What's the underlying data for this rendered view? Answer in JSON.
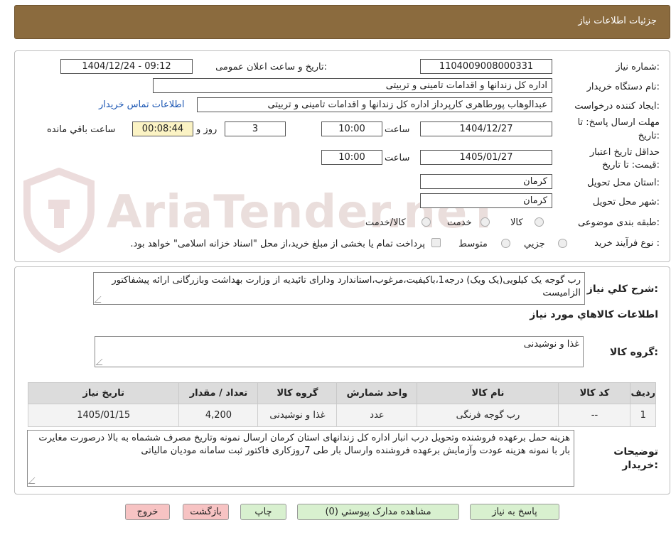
{
  "header": {
    "title": "جزئیات اطلاعات نیاز"
  },
  "form": {
    "need_number": {
      "label": "شماره نیاز:",
      "value": "1104009008000331"
    },
    "announce": {
      "label": "تاریخ و ساعت اعلان عمومی:",
      "value": "1404/12/24 - 09:12"
    },
    "buyer_org": {
      "label": "نام دستگاه خریدار:",
      "value": "اداره کل زندانها و اقدامات تامینی و تربیتی"
    },
    "requester": {
      "label": "ایجاد کننده درخواست:",
      "value": "عبدالوهاب پورطاهری کارپرداز اداره کل زندانها و اقدامات تامینی و تربیتی",
      "link": "اطلاعات تماس خریدار"
    },
    "reply_deadline": {
      "label_line1": "مهلت ارسال پاسخ: تا",
      "label_line2": "تاریخ:",
      "date": "1404/12/27",
      "time_label": "ساعت",
      "time": "10:00",
      "days": "3",
      "days_label": "روز و",
      "remaining": "00:08:44",
      "remaining_label": "ساعت باقي مانده"
    },
    "price_validity": {
      "label_line1": "حداقل تاریخ اعتبار",
      "label_line2": "قیمت: تا تاریخ:",
      "date": "1405/01/27",
      "time_label": "ساعت",
      "time": "10:00"
    },
    "province": {
      "label": "استان محل تحویل:",
      "value": "کرمان"
    },
    "city": {
      "label": "شهر محل تحویل:",
      "value": "کرمان"
    },
    "category": {
      "label": "طبقه بندی موضوعی:",
      "options": [
        "کالا",
        "خدمت",
        "کالا/خدمت"
      ]
    },
    "process": {
      "label": "نوع فرآیند خرید :",
      "options": [
        "جزیي",
        "متوسط"
      ],
      "note": "پرداخت تمام یا بخشی از مبلغ خرید،از محل \"اسناد خزانه اسلامی\" خواهد بود."
    }
  },
  "description": {
    "label": "شرح کلي نياز:",
    "text": "رب گوجه یک کیلویی(یک ویک) درجه1،باکیفیت،مرغوب،استاندارد ودارای تائیدیه از وزارت بهداشت وبازرگانی ارائه پیشفاکتور الزامیست"
  },
  "goods_info": {
    "title": "اطلاعات کالاهاي مورد نياز"
  },
  "goods_group": {
    "label": "گروه کالا:",
    "value": "غذا و نوشیدنی"
  },
  "table": {
    "headers": [
      "ردیف",
      "کد کالا",
      "نام کالا",
      "واحد شمارش",
      "گروه کالا",
      "تعداد / مقدار",
      "تاریخ نیاز"
    ],
    "rows": [
      [
        "1",
        "--",
        "رب گوجه فرنگی",
        "عدد",
        "غذا و نوشیدنی",
        "4,200",
        "1405/01/15"
      ]
    ]
  },
  "buyer_notes": {
    "label_line1": "توضیحات",
    "label_line2": "خریدار:",
    "text": "هزینه حمل برعهده فروشنده وتحویل درب انبار اداره کل زندانهای استان کرمان ارسال نمونه وتاریخ مصرف ششماه به بالا درصورت مغایرت بار با نمونه هزینه عودت وآزمایش برعهده فروشنده وارسال بار طی 7روزکاری فاکتور ثبت سامانه مودیان مالیاتی"
  },
  "buttons": {
    "reply": "پاسخ به نیاز",
    "attachments": "مشاهده مدارک پیوستي (0)",
    "print": "چاپ",
    "back": "بازگشت",
    "exit": "خروج"
  },
  "watermark": "AriaTender.neT",
  "colors": {
    "header": "#8b6b3e",
    "button_green": "#d8f0cf",
    "button_pink": "#f7c3c3",
    "link": "#1b56b3",
    "remaining_bg": "#fbf3c4"
  }
}
